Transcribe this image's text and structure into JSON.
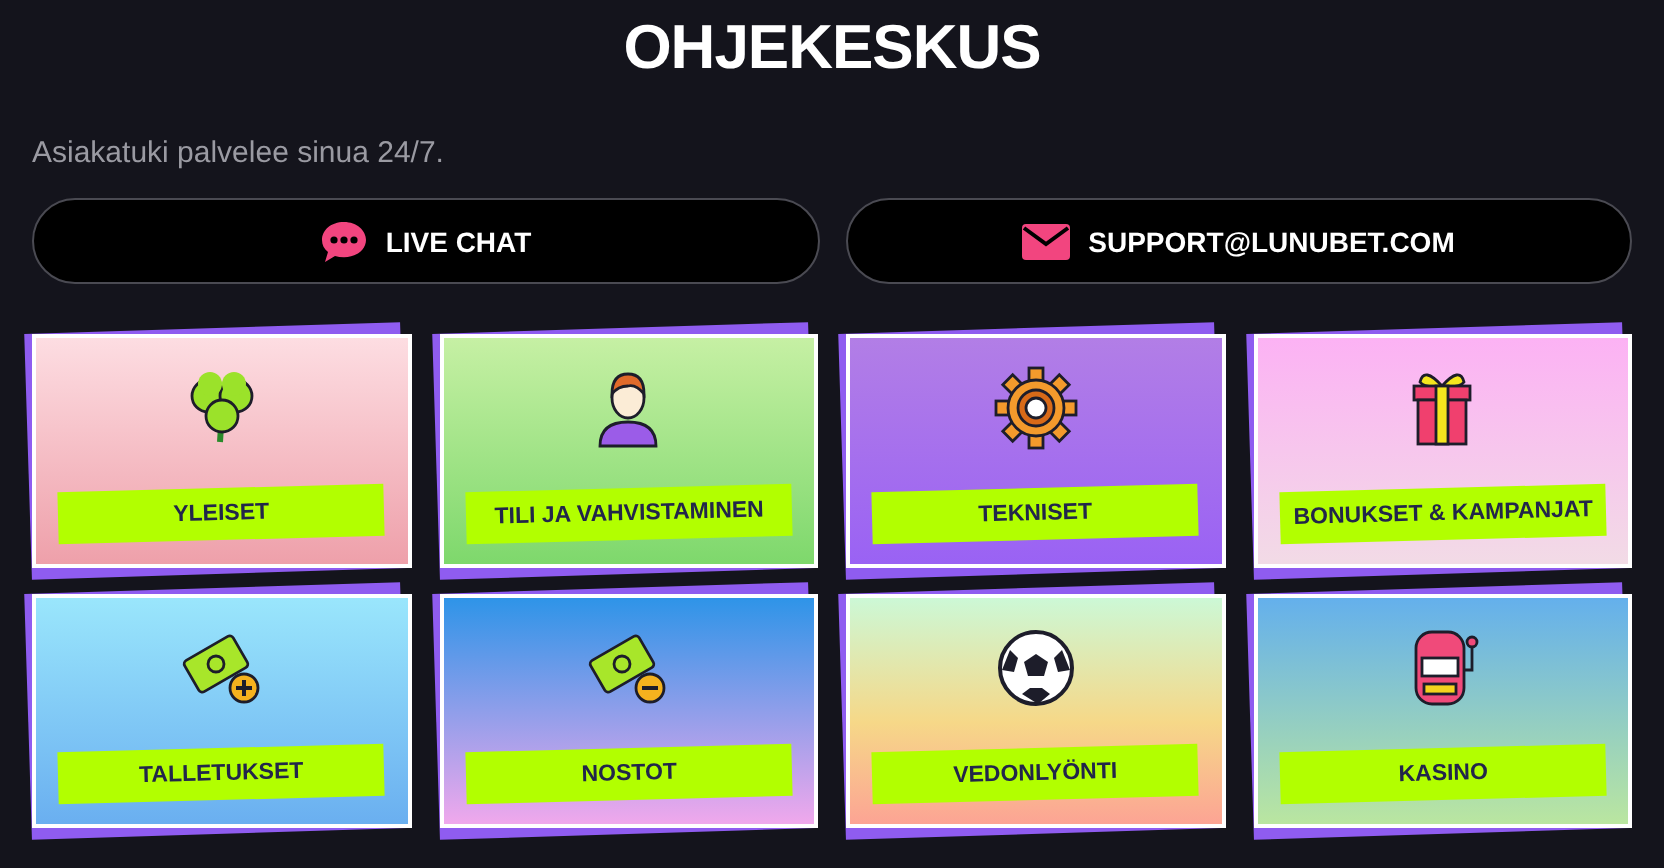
{
  "title": "OHJEKESKUS",
  "subtitle": "Asiakatuki palvelee sinua 24/7.",
  "contact_buttons": [
    {
      "kind": "chat",
      "label": "LIVE CHAT"
    },
    {
      "kind": "mail",
      "label": "SUPPORT@LUNUBET.COM"
    }
  ],
  "categories": [
    {
      "kind": "clover",
      "label": "YLEISET"
    },
    {
      "kind": "person",
      "label": "TILI JA VAHVISTAMINEN"
    },
    {
      "kind": "gear",
      "label": "TEKNISET"
    },
    {
      "kind": "gift",
      "label": "BONUKSET & KAMPANJAT"
    },
    {
      "kind": "deposit",
      "label": "TALLETUKSET"
    },
    {
      "kind": "withdraw",
      "label": "NOSTOT"
    },
    {
      "kind": "ball",
      "label": "VEDONLYÖNTI"
    },
    {
      "kind": "slot",
      "label": "KASINO"
    }
  ]
}
